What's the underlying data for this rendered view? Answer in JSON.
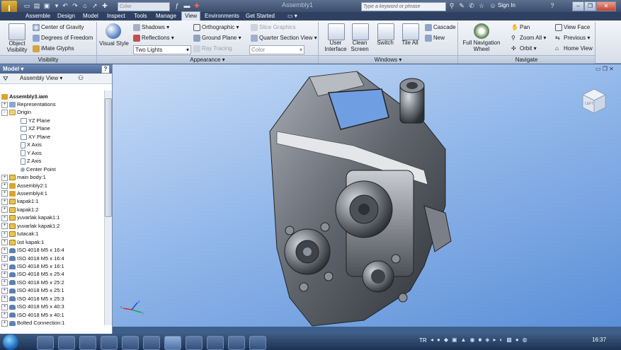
{
  "app": {
    "logo_text": "I",
    "document_title": "Assembly1"
  },
  "quick_access": {
    "color_combo": "Color",
    "search_placeholder": "Type a keyword or phrase",
    "sign_in": "Sign In",
    "help": "?"
  },
  "menu_tabs": [
    {
      "label": "Assemble",
      "active": false
    },
    {
      "label": "Design",
      "active": false
    },
    {
      "label": "Model",
      "active": false
    },
    {
      "label": "Inspect",
      "active": false
    },
    {
      "label": "Tools",
      "active": false
    },
    {
      "label": "Manage",
      "active": false
    },
    {
      "label": "View",
      "active": true
    },
    {
      "label": "Environments",
      "active": false
    },
    {
      "label": "Get Started",
      "active": false
    }
  ],
  "ribbon": {
    "visibility": {
      "panel_label": "Visibility",
      "object_visibility": "Object Visibility",
      "center_of_gravity": "Center of Gravity",
      "degrees_of_freedom": "Degrees of Freedom",
      "imate_glyphs": "iMate Glyphs"
    },
    "appearance": {
      "panel_label": "Appearance",
      "visual_style": "Visual Style",
      "shadows": "Shadows",
      "reflections": "Reflections",
      "lighting_combo": "Two Lights",
      "orthographic": "Orthographic",
      "ground_plane": "Ground Plane",
      "ray_tracing": "Ray Tracing",
      "slice_graphics": "Slice Graphics",
      "quarter_section_view": "Quarter Section View",
      "color_combo": "Color"
    },
    "windows": {
      "panel_label": "Windows",
      "user_interface": "User Interface",
      "clean_screen": "Clean Screen",
      "switch": "Switch",
      "tile_all": "Tile All",
      "cascade": "Cascade",
      "new": "New"
    },
    "navigate": {
      "panel_label": "Navigate",
      "full_navigation_wheel": "Full Navigation Wheel",
      "pan": "Pan",
      "zoom_all": "Zoom All",
      "orbit": "Orbit",
      "view_face": "View Face",
      "previous": "Previous",
      "home_view": "Home View"
    }
  },
  "browser": {
    "title": "Model",
    "view_mode": "Assembly View",
    "help": "?",
    "root": "Assembly3.iam",
    "items": [
      {
        "label": "Representations",
        "icon": "rep",
        "indent": 0,
        "pm": "+"
      },
      {
        "label": "Origin",
        "icon": "fold",
        "indent": 0,
        "pm": "-"
      },
      {
        "label": "YZ Plane",
        "icon": "plane",
        "indent": 1,
        "pm": ""
      },
      {
        "label": "XZ Plane",
        "icon": "plane",
        "indent": 1,
        "pm": ""
      },
      {
        "label": "XY Plane",
        "icon": "plane",
        "indent": 1,
        "pm": ""
      },
      {
        "label": "X Axis",
        "icon": "axis",
        "indent": 1,
        "pm": ""
      },
      {
        "label": "Y Axis",
        "icon": "axis",
        "indent": 1,
        "pm": ""
      },
      {
        "label": "Z Axis",
        "icon": "axis",
        "indent": 1,
        "pm": ""
      },
      {
        "label": "Center Point",
        "icon": "pt",
        "indent": 1,
        "pm": ""
      },
      {
        "label": "main body:1",
        "icon": "part",
        "indent": 0,
        "pm": "+"
      },
      {
        "label": "Assembly2:1",
        "icon": "asm",
        "indent": 0,
        "pm": "+"
      },
      {
        "label": "Assembly4:1",
        "icon": "asm",
        "indent": 0,
        "pm": "+"
      },
      {
        "label": "kapak1:1",
        "icon": "part",
        "indent": 0,
        "pm": "+"
      },
      {
        "label": "kapak1:2",
        "icon": "part",
        "indent": 0,
        "pm": "+"
      },
      {
        "label": "yuvarlak kapak1:1",
        "icon": "part",
        "indent": 0,
        "pm": "+"
      },
      {
        "label": "yuvarlak kapak1:2",
        "icon": "part",
        "indent": 0,
        "pm": "+"
      },
      {
        "label": "tutacak:1",
        "icon": "part",
        "indent": 0,
        "pm": "+"
      },
      {
        "label": "üst kapak:1",
        "icon": "part",
        "indent": 0,
        "pm": "+"
      },
      {
        "label": "ISO 4018 M5 x 16:4",
        "icon": "bolt",
        "indent": 0,
        "pm": "+"
      },
      {
        "label": "ISO 4018 M5 x 16:4",
        "icon": "bolt",
        "indent": 0,
        "pm": "+"
      },
      {
        "label": "ISO 4018 M5 x 16:1",
        "icon": "bolt",
        "indent": 0,
        "pm": "+"
      },
      {
        "label": "ISO 4018 M5 x 25:4",
        "icon": "bolt",
        "indent": 0,
        "pm": "+"
      },
      {
        "label": "ISO 4018 M5 x 25:2",
        "icon": "bolt",
        "indent": 0,
        "pm": "+"
      },
      {
        "label": "ISO 4018 M5 x 25:1",
        "icon": "bolt",
        "indent": 0,
        "pm": "+"
      },
      {
        "label": "ISO 4018 M5 x 25:3",
        "icon": "bolt",
        "indent": 0,
        "pm": "+"
      },
      {
        "label": "ISO 4018 M5 x 40:3",
        "icon": "bolt",
        "indent": 0,
        "pm": "+"
      },
      {
        "label": "ISO 4018 M5 x 40:1",
        "icon": "bolt",
        "indent": 0,
        "pm": "+"
      },
      {
        "label": "Bolted Connection:1",
        "icon": "bolt",
        "indent": 0,
        "pm": "+"
      }
    ]
  },
  "viewcube": {
    "face_label": "LEFT"
  },
  "taskbar": {
    "language": "TR",
    "clock": "16:37"
  }
}
